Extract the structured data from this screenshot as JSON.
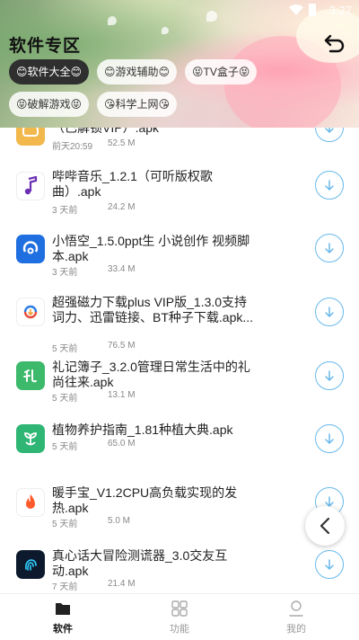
{
  "status_bar": {
    "time": "3:27"
  },
  "header": {
    "title": "软件专区"
  },
  "tags": [
    {
      "label": "😊软件大全😊",
      "active": true
    },
    {
      "label": "😊游戏辅助😊",
      "active": false
    },
    {
      "label": "😝TV盒子😝",
      "active": false
    },
    {
      "label": "😝破解游戏😝",
      "active": false
    },
    {
      "label": "😘科学上网😘",
      "active": false
    }
  ],
  "apps": [
    {
      "name": "（已解锁VIP）.apk",
      "time": "前天20:59",
      "size": "52.5 M",
      "icon": "unknown-app-icon",
      "color": "#f2b84b"
    },
    {
      "name": "哔哔音乐_1.2.1（可听版权歌曲）.apk",
      "time": "3 天前",
      "size": "24.2 M",
      "icon": "music-note-icon",
      "color": "#6b2fb3"
    },
    {
      "name": "小悟空_1.5.0ppt生 小说创作 视频脚本.apk",
      "time": "3 天前",
      "size": "33.4 M",
      "icon": "wukong-icon",
      "color": "#1f6fe0"
    },
    {
      "name": "超强磁力下载plus VIP版_1.3.0支持词力、迅雷链接、BT种子下载.apk...",
      "time": "5 天前",
      "size": "76.5 M",
      "icon": "magnet-download-icon",
      "color": "#e84b3c"
    },
    {
      "name": "礼记簿子_3.2.0管理日常生活中的礼尚往来.apk",
      "time": "5 天前",
      "size": "13.1 M",
      "icon": "gift-book-icon",
      "color": "#3cb96a"
    },
    {
      "name": "植物养护指南_1.81种植大典.apk",
      "time": "5 天前",
      "size": "65.0 M",
      "icon": "plant-icon",
      "color": "#2fb574"
    },
    {
      "name": "暖手宝_V1.2CPU高负载实现的发热.apk",
      "time": "5 天前",
      "size": "5.0 M",
      "icon": "flame-icon",
      "color": "#ff5a2b"
    },
    {
      "name": "真心话大冒险测谎器_3.0交友互动.apk",
      "time": "7 天前",
      "size": "21.4 M",
      "icon": "fingerprint-icon",
      "color": "#0d1a2e"
    }
  ],
  "nav": [
    {
      "label": "软件",
      "active": true
    },
    {
      "label": "功能",
      "active": false
    },
    {
      "label": "我的",
      "active": false
    }
  ]
}
